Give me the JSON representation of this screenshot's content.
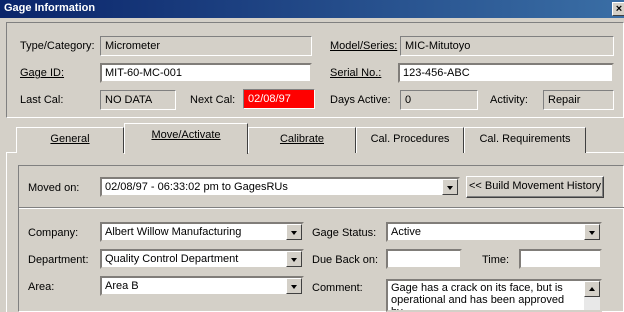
{
  "window": {
    "title": "Gage Information",
    "close_glyph": "×"
  },
  "header": {
    "type_category_label": "Type/Category:",
    "type_category_value": "Micrometer",
    "model_series_label": "Model/Series:",
    "model_series_value": "MIC-Mitutoyo",
    "gage_id_label": "Gage ID:",
    "gage_id_value": "MIT-60-MC-001",
    "serial_no_label": "Serial No.:",
    "serial_no_value": "123-456-ABC",
    "last_cal_label": "Last Cal:",
    "last_cal_value": "NO DATA",
    "next_cal_label": "Next Cal:",
    "next_cal_value": "02/08/97",
    "days_active_label": "Days Active:",
    "days_active_value": "0",
    "activity_label": "Activity:",
    "activity_value": "Repair",
    "overdue_color": "#ff0000"
  },
  "tabs": [
    {
      "label": "General"
    },
    {
      "label": "Move/Activate"
    },
    {
      "label": "Calibrate"
    },
    {
      "label": "Cal. Procedures"
    },
    {
      "label": "Cal. Requirements"
    }
  ],
  "active_tab": "Move/Activate",
  "move": {
    "moved_on_label": "Moved on:",
    "moved_on_value": "02/08/97 - 06:33:02 pm to GagesRUs",
    "build_history_button": "<< Build Movement History"
  },
  "details": {
    "company_label": "Company:",
    "company_value": "Albert Willow Manufacturing",
    "department_label": "Department:",
    "department_value": "Quality Control Department",
    "area_label": "Area:",
    "area_value": "Area B",
    "gage_status_label": "Gage Status:",
    "gage_status_value": "Active",
    "due_back_label": "Due Back on:",
    "due_back_value": "",
    "time_label": "Time:",
    "time_value": "",
    "comment_label": "Comment:",
    "comment_value": "Gage has a crack on its face, but is operational and has been approved by"
  }
}
